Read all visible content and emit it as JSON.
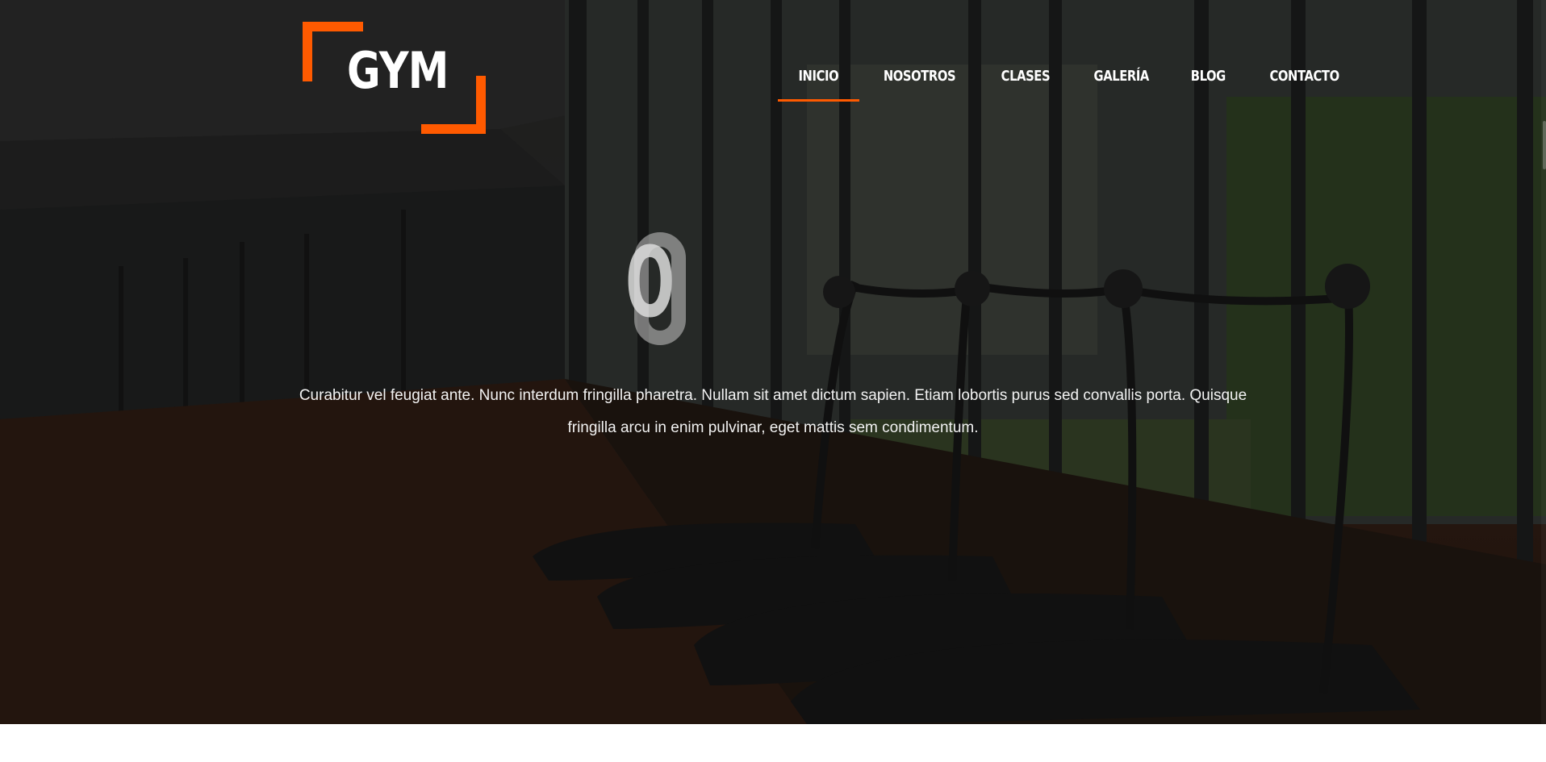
{
  "site": {
    "logo_text": "GYM",
    "accent_color": "#ff5a00"
  },
  "nav": {
    "items": [
      {
        "label": "INICIO",
        "active": true
      },
      {
        "label": "NOSOTROS",
        "active": false
      },
      {
        "label": "CLASES",
        "active": false
      },
      {
        "label": "GALERÍA",
        "active": false
      },
      {
        "label": "BLOG",
        "active": false
      },
      {
        "label": "CONTACTO",
        "active": false
      }
    ]
  },
  "hero": {
    "big_glyph": "O",
    "text": "Curabitur vel feugiat ante. Nunc interdum fringilla pharetra. Nullam sit amet dictum sapien. Etiam lobortis purus sed convallis porta. Quisque fringilla arcu in enim pulvinar, eget mattis sem condimentum.",
    "background_image": "dark-gym-interior-with-treadmills-and-windows"
  }
}
